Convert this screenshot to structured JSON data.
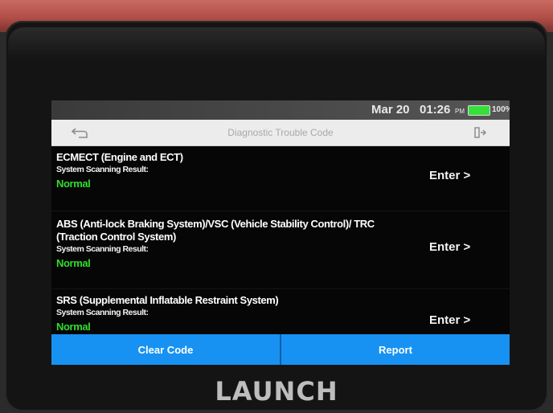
{
  "device": {
    "brand": "LAUNCH"
  },
  "status_bar": {
    "date": "Mar 20",
    "time": "01:26",
    "ampm": "PM",
    "battery_percent": "100%",
    "battery_level": 1.0,
    "battery_color": "#35e03a"
  },
  "header": {
    "title": "Diagnostic Trouble Code",
    "back_icon": "back-arrow-icon",
    "exit_icon": "exit-icon"
  },
  "systems": [
    {
      "name": "ECMECT (Engine and ECT)",
      "scan_label": "System Scanning Result:",
      "result": "Normal",
      "enter_label": "Enter >"
    },
    {
      "name": "ABS (Anti-lock Braking System)/VSC (Vehicle Stability Control)/ TRC (Traction Control System)",
      "scan_label": "System Scanning Result:",
      "result": "Normal",
      "enter_label": "Enter >"
    },
    {
      "name": "SRS (Supplemental Inflatable Restraint System)",
      "scan_label": "System Scanning Result:",
      "result": "Normal",
      "enter_label": "Enter >"
    }
  ],
  "footer": {
    "clear_code_label": "Clear Code",
    "report_label": "Report"
  },
  "colors": {
    "accent": "#1792f2",
    "result_ok": "#32dc2e"
  }
}
